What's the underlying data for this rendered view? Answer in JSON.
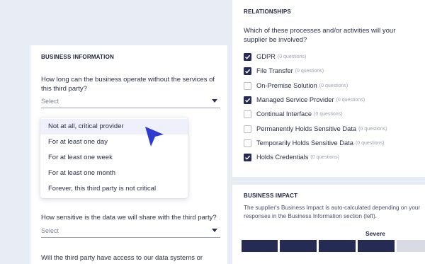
{
  "business_information": {
    "title": "BUSINESS INFORMATION",
    "question1": "How long can the business operate without the services of this third party?",
    "select1_value": "Select",
    "dropdown_options": [
      "Not at all, critical provider",
      "For at least one day",
      "For at least one week",
      "For at least one month",
      "Forever, this third party is not critical"
    ],
    "question2": "How sensitive is the data we will share with the third party?",
    "select2_value": "Select",
    "question3": "Will the third party have access to our data systems or"
  },
  "relationships": {
    "title": "RELATIONSHIPS",
    "question": "Which of these processes and/or activities will your supplier be involved?",
    "items": [
      {
        "label": "GDPR",
        "count": "(0 questions)",
        "checked": true
      },
      {
        "label": "File Transfer",
        "count": "(0  questions)",
        "checked": true
      },
      {
        "label": "On-Premise Solution",
        "count": "(0 questions)",
        "checked": false
      },
      {
        "label": "Managed Service Provider",
        "count": "(0 questions)",
        "checked": true
      },
      {
        "label": "Continual Interface",
        "count": "(0 questions)",
        "checked": false
      },
      {
        "label": "Permanently Holds Sensitive Data",
        "count": "(0 questions)",
        "checked": false
      },
      {
        "label": "Temporarily Holds Sensitive Data",
        "count": "(0 questions)",
        "checked": false
      },
      {
        "label": "Holds Credentials",
        "count": "(0 questions)",
        "checked": true
      }
    ]
  },
  "business_impact": {
    "title": "BUSINESS IMPACT",
    "description": "The supplier's Business Impact is auto-calculated depending on your responses in the Business Information section (left).",
    "level_label": "Severe",
    "filled_segments": 4,
    "total_segments": 5
  },
  "colors": {
    "background": "#e8ecf5",
    "accent": "#252a57",
    "cursor": "#2f3bd0"
  }
}
